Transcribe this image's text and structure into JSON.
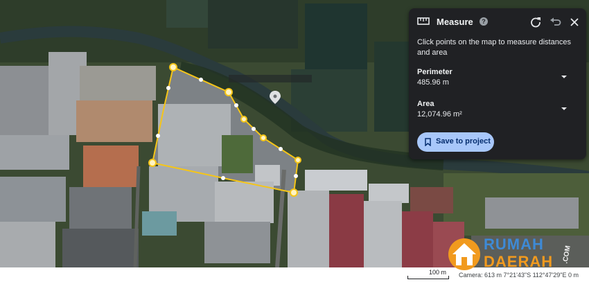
{
  "panel": {
    "title": "Measure",
    "help_icon": "?",
    "instruction": "Click points on the map to measure distances and area",
    "perimeter_label": "Perimeter",
    "perimeter_value": "485.96 m",
    "area_label": "Area",
    "area_value": "12,074.96 m²",
    "save_label": "Save to project",
    "icons": [
      "ruler-icon",
      "help-icon",
      "refresh-icon",
      "undo-icon",
      "close-icon",
      "chevron-down-icon",
      "bookmark-icon"
    ]
  },
  "status_bar": {
    "scale_label": "100 m",
    "camera_text": "Camera: 613 m  7°21'43\"S 112°47'29\"E  0 m"
  },
  "watermark": {
    "line1": "RUMAH",
    "line2": "DAERAH",
    "suffix": ".COM"
  },
  "colors": {
    "panel_bg": "#202124",
    "button_bg": "#a8c7fa",
    "measure_line": "#f5c518",
    "watermark_blue": "#3e8ad6",
    "watermark_orange": "#f19a1e"
  }
}
